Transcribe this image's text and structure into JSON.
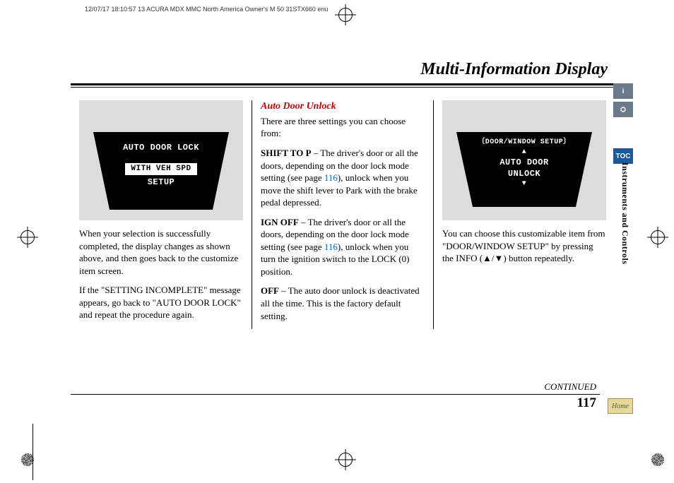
{
  "meta_header": "12/07/17 18:10:57   13 ACURA MDX MMC North America Owner's M 50 31STX660 enu",
  "page_title": "Multi-Information Display",
  "section_label": "Instruments and Controls",
  "continued": "CONTINUED",
  "page_number": "117",
  "side_tabs": {
    "info": "i",
    "car": "⛭",
    "toc": "TOC"
  },
  "home_label": "Home",
  "col1": {
    "device": {
      "line1": "AUTO DOOR LOCK",
      "line2": "WITH VEH SPD",
      "line3": "SETUP"
    },
    "p1": "When your selection is successfully completed, the display changes as shown above, and then goes back to the customize item screen.",
    "p2": "If the \"SETTING INCOMPLETE\" message appears, go back to \"AUTO DOOR LOCK\" and repeat the procedure again."
  },
  "col2": {
    "heading": "Auto Door Unlock",
    "intro": "There are three settings you can choose from:",
    "opt1_label": "SHIFT TO P",
    "opt1_text_a": " – The driver's door or all the doors, depending on the door lock mode setting (see page ",
    "opt1_page": "116",
    "opt1_text_b": "), unlock when you move the shift lever to Park with the brake pedal depressed.",
    "opt2_label": "IGN OFF",
    "opt2_text_a": " – The driver's door or all the doors, depending on the door lock mode setting (see page ",
    "opt2_page": "116",
    "opt2_text_b": "), unlock when you turn the ignition switch to the LOCK (0) position.",
    "opt3_label": "OFF",
    "opt3_text": " –  The auto door unlock is deactivated all the time. This is the factory default setting."
  },
  "col3": {
    "device": {
      "bracket": "〔DOOR/WINDOW SETUP〕",
      "arrow_up": "▲",
      "line2": "AUTO DOOR",
      "line3": "UNLOCK",
      "arrow_down": "▼"
    },
    "p1": "You can choose this customizable item from \"DOOR/WINDOW SETUP\" by pressing the INFO (▲/▼) button repeatedly."
  }
}
